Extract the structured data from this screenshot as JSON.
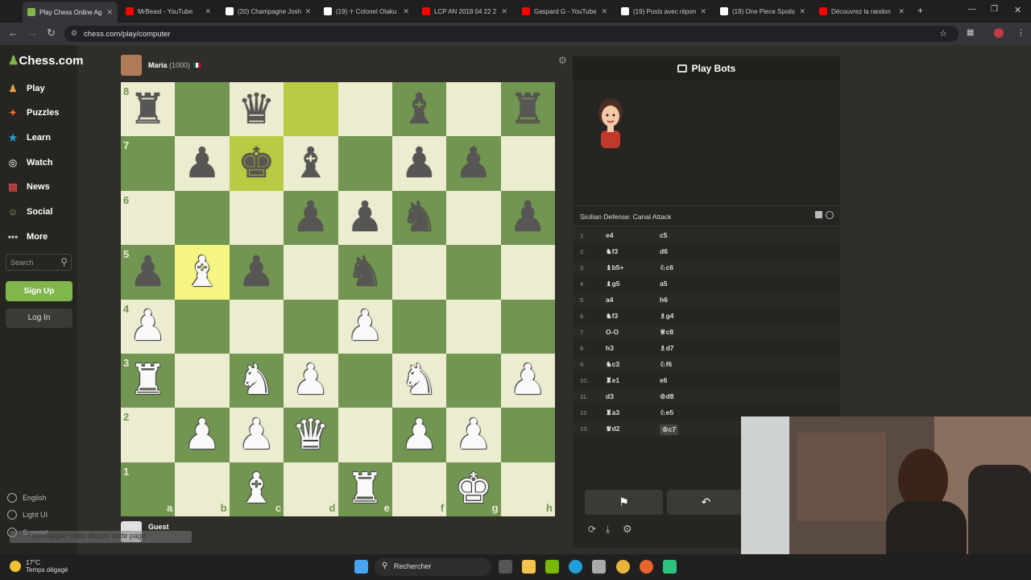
{
  "browser": {
    "tabs": [
      {
        "title": "Play Chess Online Ag",
        "active": true,
        "favicon_color": "#81b64c"
      },
      {
        "title": "MrBeast - YouTube",
        "active": false,
        "favicon_color": "#ff0000"
      },
      {
        "title": "(20) Champagne Josh",
        "active": false,
        "favicon_color": "#ffffff"
      },
      {
        "title": "(19) ☥ Colonel Otaku",
        "active": false,
        "favicon_color": "#ffffff"
      },
      {
        "title": "LCP AN 2018 04 22 2",
        "active": false,
        "favicon_color": "#ff0000"
      },
      {
        "title": "Gaspard G - YouTube",
        "active": false,
        "favicon_color": "#ff0000"
      },
      {
        "title": "(19) Posts avec répon",
        "active": false,
        "favicon_color": "#ffffff"
      },
      {
        "title": "(19) One Piece Spoils",
        "active": false,
        "favicon_color": "#ffffff"
      },
      {
        "title": "Découvrez la randon",
        "active": false,
        "favicon_color": "#ff0000"
      }
    ],
    "url": "chess.com/play/computer"
  },
  "sidebar": {
    "logo": "Chess.com",
    "items": [
      {
        "label": "Play",
        "icon": "pawn-play-icon",
        "color": "#e2a14a"
      },
      {
        "label": "Puzzles",
        "icon": "puzzle-icon",
        "color": "#e36b2c"
      },
      {
        "label": "Learn",
        "icon": "learn-icon",
        "color": "#2aa0d8"
      },
      {
        "label": "Watch",
        "icon": "binoculars-icon",
        "color": "#bbbbbb"
      },
      {
        "label": "News",
        "icon": "news-icon",
        "color": "#e04848"
      },
      {
        "label": "Social",
        "icon": "social-icon",
        "color": "#79b24d"
      },
      {
        "label": "More",
        "icon": "more-icon",
        "color": "#bbbbbb"
      }
    ],
    "search_placeholder": "Search",
    "signup": "Sign Up",
    "login": "Log In",
    "footer": [
      "English",
      "Light UI",
      "Support"
    ]
  },
  "opponent": {
    "name": "Maria",
    "rating": "(1000)"
  },
  "player": {
    "name": "Guest"
  },
  "board": {
    "ranks": [
      "8",
      "7",
      "6",
      "5",
      "4",
      "3",
      "2",
      "1"
    ],
    "files": [
      "a",
      "b",
      "c",
      "d",
      "e",
      "f",
      "g",
      "h"
    ],
    "highlights": [
      "d8",
      "c7",
      "b5"
    ],
    "pieces": [
      {
        "sq": "a8",
        "p": "♜",
        "c": "b"
      },
      {
        "sq": "c8",
        "p": "♛",
        "c": "b"
      },
      {
        "sq": "f8",
        "p": "♝",
        "c": "b"
      },
      {
        "sq": "h8",
        "p": "♜",
        "c": "b"
      },
      {
        "sq": "b7",
        "p": "♟",
        "c": "b"
      },
      {
        "sq": "c7",
        "p": "♚",
        "c": "b"
      },
      {
        "sq": "d7",
        "p": "♝",
        "c": "b"
      },
      {
        "sq": "f7",
        "p": "♟",
        "c": "b"
      },
      {
        "sq": "g7",
        "p": "♟",
        "c": "b"
      },
      {
        "sq": "d6",
        "p": "♟",
        "c": "b"
      },
      {
        "sq": "e6",
        "p": "♟",
        "c": "b"
      },
      {
        "sq": "f6",
        "p": "♞",
        "c": "b"
      },
      {
        "sq": "h6",
        "p": "♟",
        "c": "b"
      },
      {
        "sq": "a5",
        "p": "♟",
        "c": "b"
      },
      {
        "sq": "b5",
        "p": "♝",
        "c": "w"
      },
      {
        "sq": "c5",
        "p": "♟",
        "c": "b"
      },
      {
        "sq": "e5",
        "p": "♞",
        "c": "b"
      },
      {
        "sq": "a4",
        "p": "♟",
        "c": "w"
      },
      {
        "sq": "e4",
        "p": "♟",
        "c": "w"
      },
      {
        "sq": "a3",
        "p": "♜",
        "c": "w"
      },
      {
        "sq": "c3",
        "p": "♞",
        "c": "w"
      },
      {
        "sq": "d3",
        "p": "♟",
        "c": "w"
      },
      {
        "sq": "f3",
        "p": "♞",
        "c": "w"
      },
      {
        "sq": "h3",
        "p": "♟",
        "c": "w"
      },
      {
        "sq": "b2",
        "p": "♟",
        "c": "w"
      },
      {
        "sq": "c2",
        "p": "♟",
        "c": "w"
      },
      {
        "sq": "d2",
        "p": "♛",
        "c": "w"
      },
      {
        "sq": "f2",
        "p": "♟",
        "c": "w"
      },
      {
        "sq": "g2",
        "p": "♟",
        "c": "w"
      },
      {
        "sq": "c1",
        "p": "♝",
        "c": "w"
      },
      {
        "sq": "e1",
        "p": "♜",
        "c": "w"
      },
      {
        "sq": "g1",
        "p": "♚",
        "c": "w"
      }
    ]
  },
  "panel": {
    "title": "Play Bots",
    "opening": "Sicilian Defense: Canal Attack",
    "moves": [
      {
        "n": "1.",
        "w": "e4",
        "b": "c5"
      },
      {
        "n": "2.",
        "w": "♞f3",
        "b": "d6"
      },
      {
        "n": "3.",
        "w": "♝b5+",
        "b": "♘c6"
      },
      {
        "n": "4.",
        "w": "♝g5",
        "b": "a5"
      },
      {
        "n": "5.",
        "w": "a4",
        "b": "h6"
      },
      {
        "n": "6.",
        "w": "♞f3",
        "b": "♗g4"
      },
      {
        "n": "7.",
        "w": "O-O",
        "b": "♕c8"
      },
      {
        "n": "8.",
        "w": "h3",
        "b": "♗d7"
      },
      {
        "n": "9.",
        "w": "♞c3",
        "b": "♘f6"
      },
      {
        "n": "10.",
        "w": "♜e1",
        "b": "e6"
      },
      {
        "n": "11.",
        "w": "d3",
        "b": "♔d8"
      },
      {
        "n": "12.",
        "w": "♜a3",
        "b": "♘e5"
      },
      {
        "n": "13.",
        "w": "♛d2",
        "b": "♔c7"
      }
    ]
  },
  "toast": "Télécharger Vidéo depuis cette page",
  "taskbar": {
    "temp": "17°C",
    "weather": "Temps dégagé",
    "search": "Rechercher"
  }
}
